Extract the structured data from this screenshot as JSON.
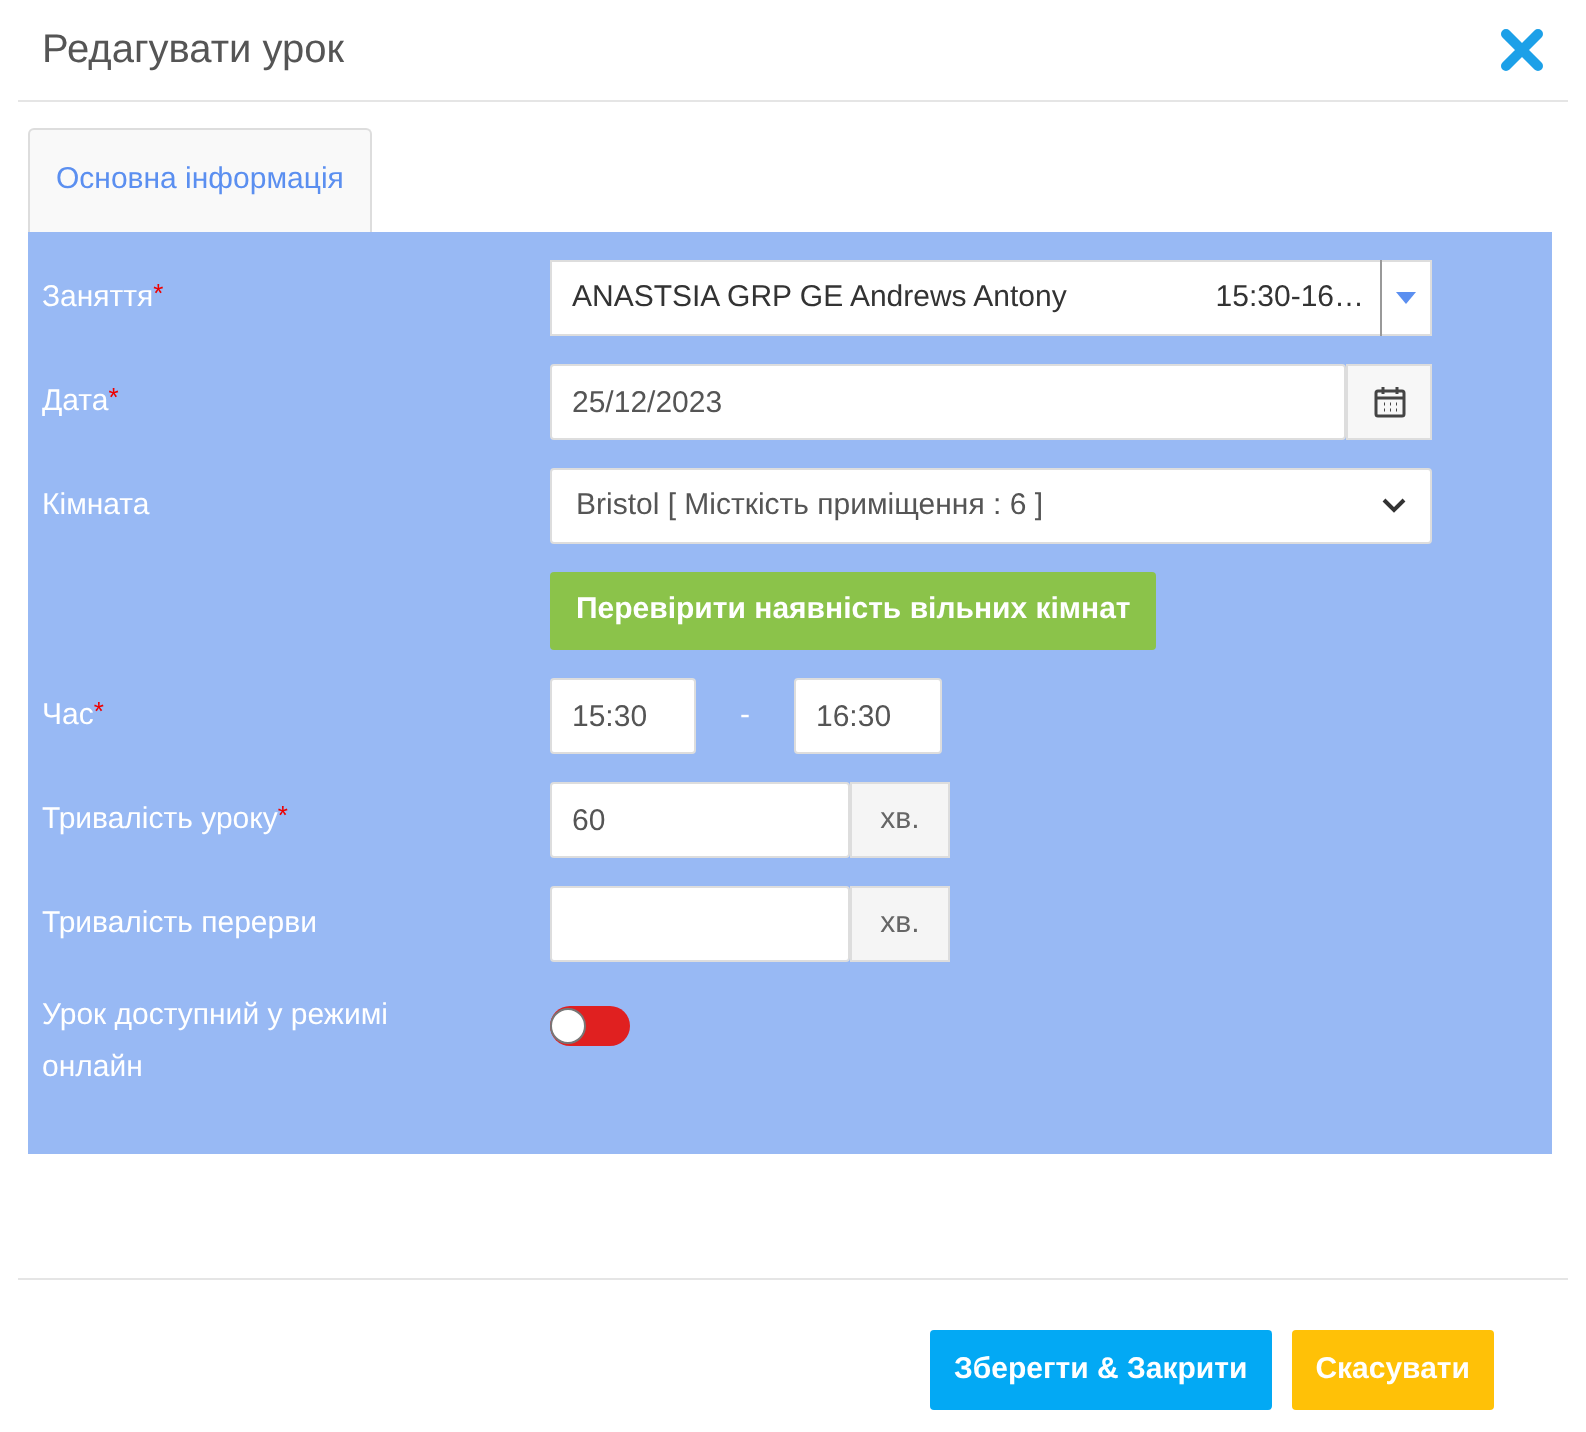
{
  "window": {
    "title": "Редагувати урок"
  },
  "tabs": [
    {
      "label": "Основна інформація",
      "selected": true
    }
  ],
  "fields": [
    {
      "kind": "combo",
      "label": "Заняття",
      "marker": "*",
      "value": "ANASTSIA GRP GE Andrews Antony",
      "extra": "15:30-16…"
    },
    {
      "kind": "date",
      "label": "Дата",
      "marker": "*",
      "value": "25/12/2023"
    },
    {
      "kind": "select",
      "label": "Кімната",
      "value": "Bristol [ Місткість приміщення : 6 ]"
    },
    {
      "kind": "action",
      "label": "Перевірити наявність вільних кімнат"
    },
    {
      "kind": "range",
      "label": "Час",
      "marker": "*",
      "from": "15:30",
      "separator": "-",
      "to": "16:30"
    },
    {
      "kind": "unit",
      "label": "Тривалість уроку",
      "marker": "*",
      "value": "60",
      "unit": "хв."
    },
    {
      "kind": "unit",
      "label": "Тривалість перерви",
      "unit": "хв."
    },
    {
      "kind": "toggle",
      "label": "Урок доступний у режимі онлайн",
      "on": false
    }
  ],
  "buttons": [
    {
      "label": "Зберегти & Закрити",
      "kind": "primary"
    },
    {
      "label": "Скасувати",
      "kind": "cancel"
    }
  ]
}
